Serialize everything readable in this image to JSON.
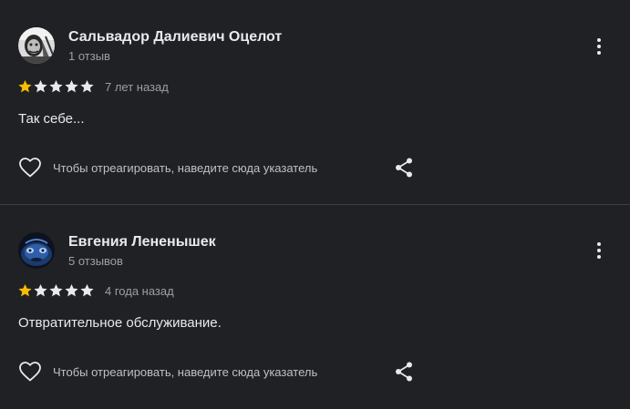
{
  "colors": {
    "background": "#202124",
    "star_filled": "#fbbc04",
    "star_empty": "#e8eaed",
    "text_primary": "#e8eaed",
    "text_secondary": "#9aa0a6"
  },
  "reviews": [
    {
      "author": "Сальвадор Далиевич Оцелот",
      "review_count": "1 отзыв",
      "rating": 1,
      "max_rating": 5,
      "time_ago": "7 лет назад",
      "text": "Так себе...",
      "react_hint": "Чтобы отреагировать, наведите сюда указатель",
      "avatar_icon": "grayscale-photo",
      "more_icon": "more-vert-icon",
      "like_icon": "heart-outline-icon",
      "share_icon": "share-icon"
    },
    {
      "author": "Евгения Лененышек",
      "review_count": "5 отзывов",
      "rating": 1,
      "max_rating": 5,
      "time_ago": "4 года назад",
      "text": "Отвратительное обслуживание.",
      "react_hint": "Чтобы отреагировать, наведите сюда указатель",
      "avatar_icon": "blue-creature-photo",
      "more_icon": "more-vert-icon",
      "like_icon": "heart-outline-icon",
      "share_icon": "share-icon"
    }
  ]
}
